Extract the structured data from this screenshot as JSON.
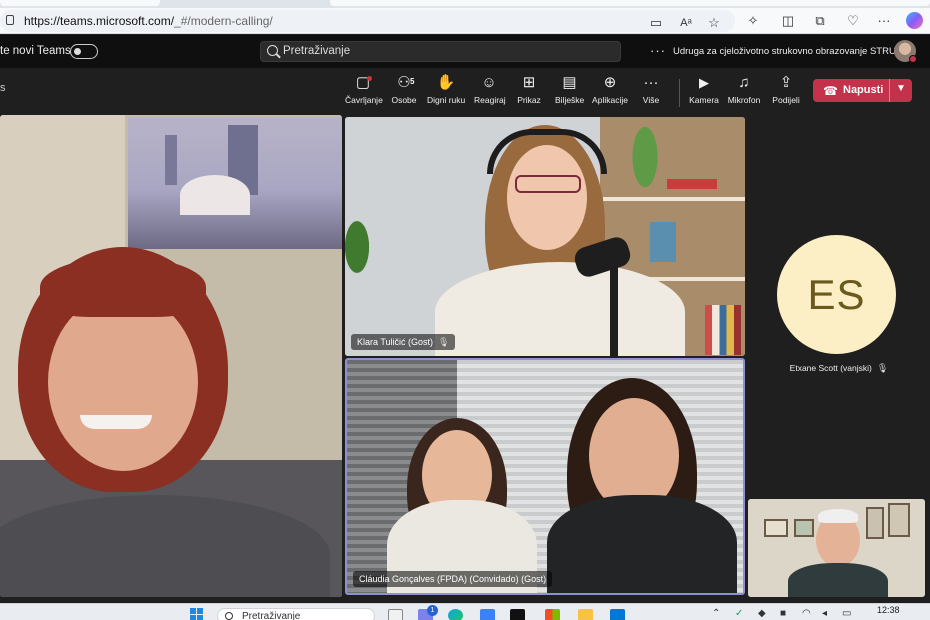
{
  "browser": {
    "url_host": "https://teams.microsoft.com/",
    "url_path": "_#/modern-calling/",
    "icons": [
      "lock-icon",
      "camera-icon",
      "read-aloud-icon",
      "favorite-star-icon",
      "extensions-icon",
      "split-screen-icon",
      "collections-icon",
      "favorites-icon",
      "more-icon",
      "copilot-icon"
    ]
  },
  "titlebar": {
    "new_teams_label": "te novi Teams",
    "search_placeholder": "Pretraživanje",
    "more_glyph": "···",
    "org_name": "Udruga za cjeloživotno strukovno obrazovanje STRUKA",
    "presence_color": "#c4314b"
  },
  "callbar": {
    "left_text": "s",
    "tools": [
      {
        "id": "chat",
        "label": "Čavrljanje",
        "icon": "chat-icon",
        "glyph": "☐"
      },
      {
        "id": "people",
        "label": "Osobe",
        "icon": "people-icon",
        "glyph": "⚇",
        "count": "5"
      },
      {
        "id": "raise-hand",
        "label": "Digni ruku",
        "icon": "hand-icon",
        "glyph": "✋"
      },
      {
        "id": "react",
        "label": "Reagiraj",
        "icon": "smiley-icon",
        "glyph": "☺"
      },
      {
        "id": "view",
        "label": "Prikaz",
        "icon": "grid-icon",
        "glyph": "⊞"
      },
      {
        "id": "notes",
        "label": "Bilješke",
        "icon": "notes-icon",
        "glyph": "▤"
      },
      {
        "id": "apps",
        "label": "Aplikacije",
        "icon": "add-apps-icon",
        "glyph": "⊕"
      },
      {
        "id": "more",
        "label": "Više",
        "icon": "more-icon",
        "glyph": "···"
      },
      {
        "id": "camera",
        "label": "Kamera",
        "icon": "camera-icon",
        "glyph": "■"
      },
      {
        "id": "mic",
        "label": "Mikrofon",
        "icon": "microphone-icon",
        "glyph": "🎙"
      },
      {
        "id": "share",
        "label": "Podijeli",
        "icon": "share-icon",
        "glyph": "⇪"
      }
    ],
    "leave_label": "Napusti",
    "leave_color": "#c4314b"
  },
  "participants": {
    "klara": {
      "name": "Klara Tuličić (Gost)"
    },
    "claudia": {
      "name": "Cláudia Gonçalves (FPDA) (Convidado) (Gost)"
    },
    "es": {
      "initials": "ES",
      "name": "Etxane Scott (vanjski)"
    },
    "active_speaker_border": "#8f8fd6"
  },
  "taskbar": {
    "search_placeholder": "Pretraživanje",
    "badge_count": "1",
    "time": "12:38"
  }
}
